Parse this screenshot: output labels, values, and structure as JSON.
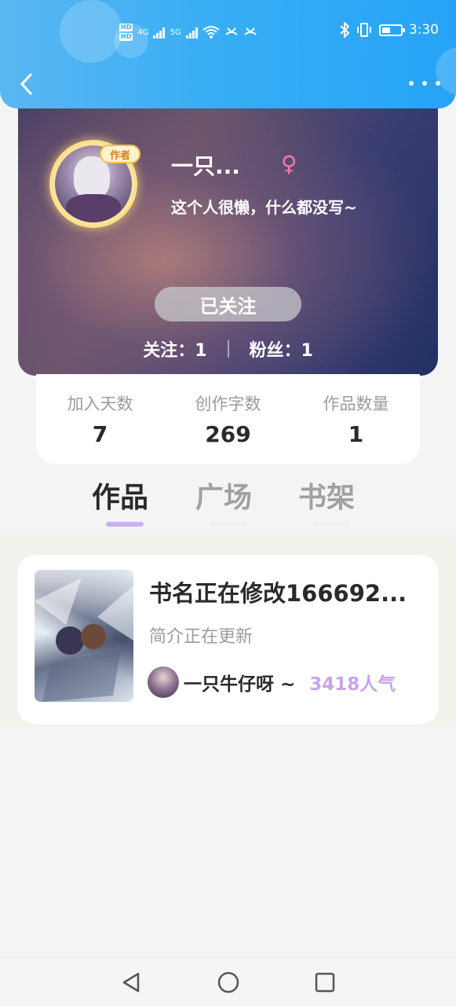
{
  "status_bar": {
    "network_labels": [
      "4G",
      "5G"
    ],
    "time": "3:30"
  },
  "header": {
    "back_icon": "chevron-left-icon",
    "more_icon": "more-dots-icon"
  },
  "profile": {
    "badge": "作者",
    "nickname": "一只...",
    "gender_symbol": "♀",
    "bio": "这个人很懒，什么都没写~",
    "follow_button": "已关注",
    "following": "关注：1",
    "followers": "粉丝：1"
  },
  "stats": [
    {
      "label": "加入天数",
      "value": "7"
    },
    {
      "label": "创作字数",
      "value": "269"
    },
    {
      "label": "作品数量",
      "value": "1"
    }
  ],
  "tabs": [
    {
      "label": "作品",
      "active": true
    },
    {
      "label": "广场",
      "active": false
    },
    {
      "label": "书架",
      "active": false
    }
  ],
  "books": [
    {
      "title": "书名正在修改166692...",
      "intro": "简介正在更新",
      "author": "一只牛仔呀 ~",
      "popularity": "3418人气"
    }
  ],
  "colors": {
    "header_blue": "#36aef5",
    "active_tab_underline": "#c9b1ef",
    "popularity_purple": "#c9a3ea",
    "gender_pink": "#f07aa8"
  }
}
